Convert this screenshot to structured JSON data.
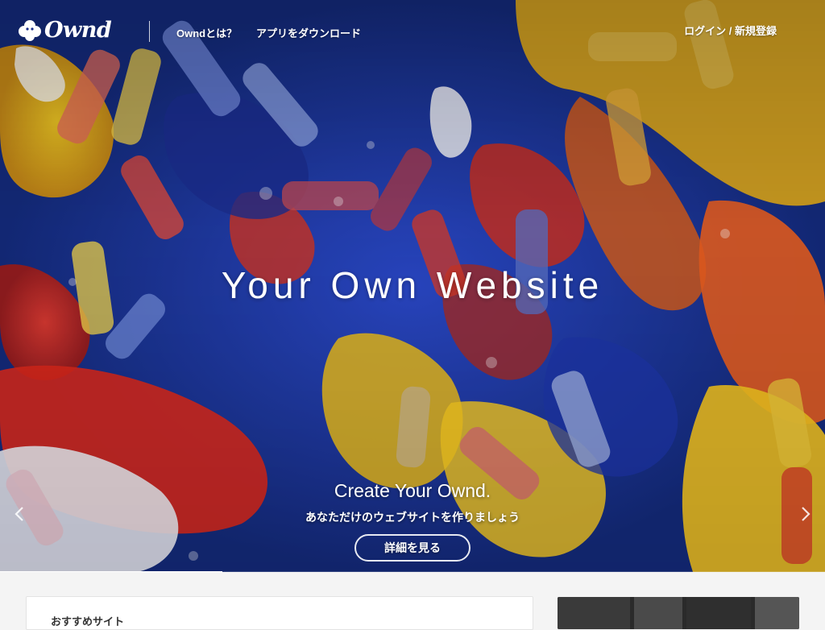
{
  "header": {
    "logo_text": "Ownd",
    "nav": {
      "about": "Owndとは？",
      "app": "アプリをダウンロード",
      "login": "ログイン / 新規登録"
    }
  },
  "hero": {
    "title": "Your Own Website",
    "subtitle": "Create Your Ownd.",
    "subtitle_jp": "あなただけのウェブサイトを作りましょう",
    "button_label": "詳細を見る",
    "slide_progress": 0.27,
    "prev_icon": "chevron-left-icon",
    "next_icon": "chevron-right-icon"
  },
  "sections": {
    "recommended_title": "おすすめサイト"
  },
  "colors": {
    "nav_text": "#ffffff",
    "page_background": "#f4f4f4",
    "card_background": "#ffffff"
  }
}
